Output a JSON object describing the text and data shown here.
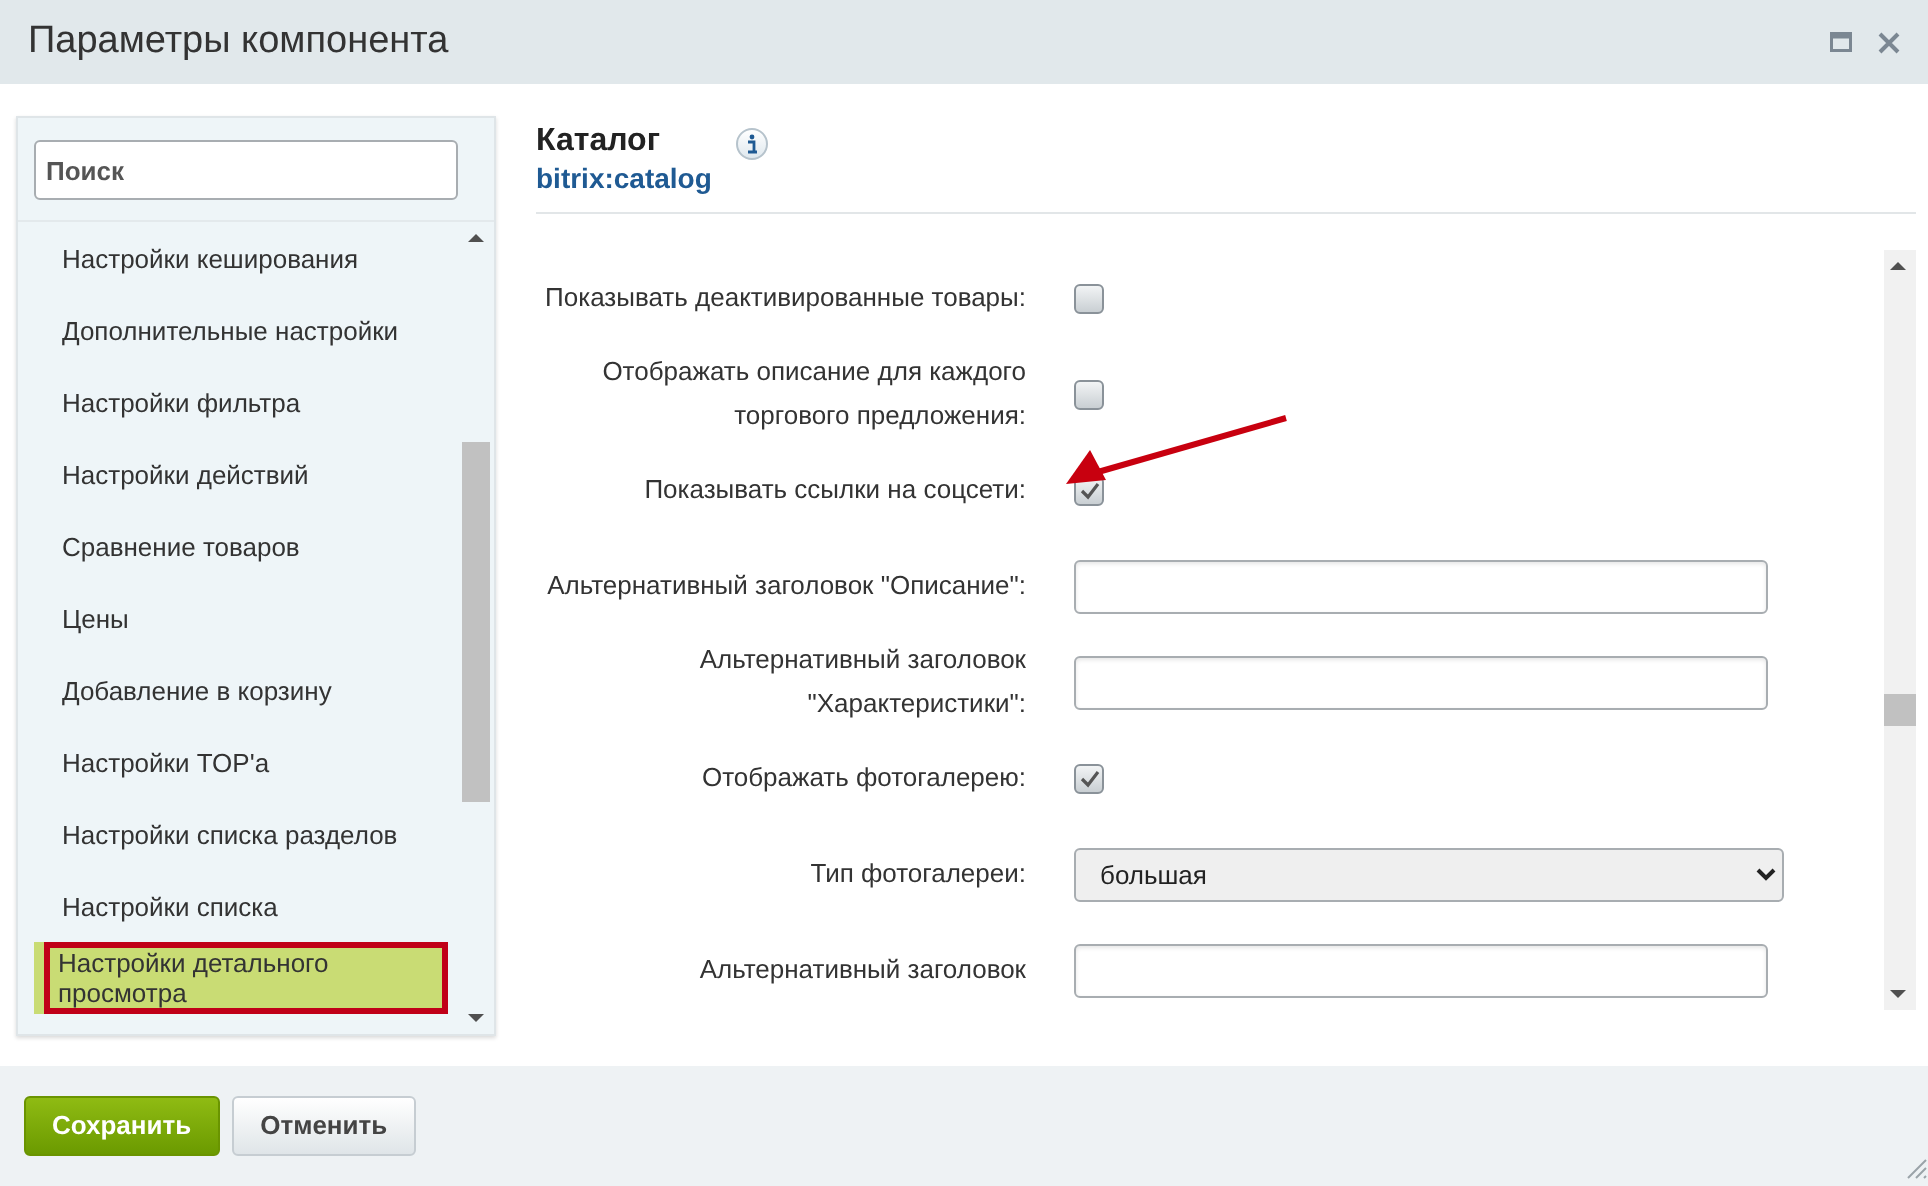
{
  "window": {
    "title": "Параметры компонента"
  },
  "sidebar": {
    "search": {
      "placeholder": "Поиск"
    },
    "items": [
      {
        "label": "Настройки кеширования",
        "selected": false,
        "highlighted": false
      },
      {
        "label": "Дополнительные настройки",
        "selected": false,
        "highlighted": false
      },
      {
        "label": "Настройки фильтра",
        "selected": false,
        "highlighted": false
      },
      {
        "label": "Настройки действий",
        "selected": false,
        "highlighted": false
      },
      {
        "label": "Сравнение товаров",
        "selected": false,
        "highlighted": false
      },
      {
        "label": "Цены",
        "selected": false,
        "highlighted": false
      },
      {
        "label": "Добавление в корзину",
        "selected": false,
        "highlighted": false
      },
      {
        "label": "Настройки TOP'а",
        "selected": false,
        "highlighted": false
      },
      {
        "label": "Настройки списка разделов",
        "selected": false,
        "highlighted": false
      },
      {
        "label": "Настройки списка",
        "selected": false,
        "highlighted": false
      },
      {
        "label": "Настройки детального просмотра",
        "selected": true,
        "highlighted": true
      }
    ]
  },
  "component": {
    "title": "Каталог",
    "code": "bitrix:catalog"
  },
  "fields": [
    {
      "kind": "checkbox",
      "label": "Показывать деактивированные товары:",
      "checked": false,
      "pointed": false
    },
    {
      "kind": "checkbox",
      "label": "Отображать описание для каждого торгового предложения:",
      "checked": false,
      "pointed": false
    },
    {
      "kind": "checkbox",
      "label": "Показывать ссылки на соцсети:",
      "checked": true,
      "pointed": true
    },
    {
      "kind": "text",
      "label": "Альтернативный заголовок \"Описание\":"
    },
    {
      "kind": "text",
      "label": "Альтернативный заголовок \"Характеристики\":"
    },
    {
      "kind": "checkbox",
      "label": "Отображать фотогалерею:",
      "checked": true,
      "pointed": false
    },
    {
      "kind": "select",
      "label": "Тип фотогалереи:",
      "value": "большая"
    },
    {
      "kind": "text",
      "label": "Альтернативный заголовок"
    }
  ],
  "buttons": [
    {
      "label": "Сохранить",
      "kind": "primary"
    },
    {
      "label": "Отменить",
      "kind": "secondary"
    }
  ]
}
